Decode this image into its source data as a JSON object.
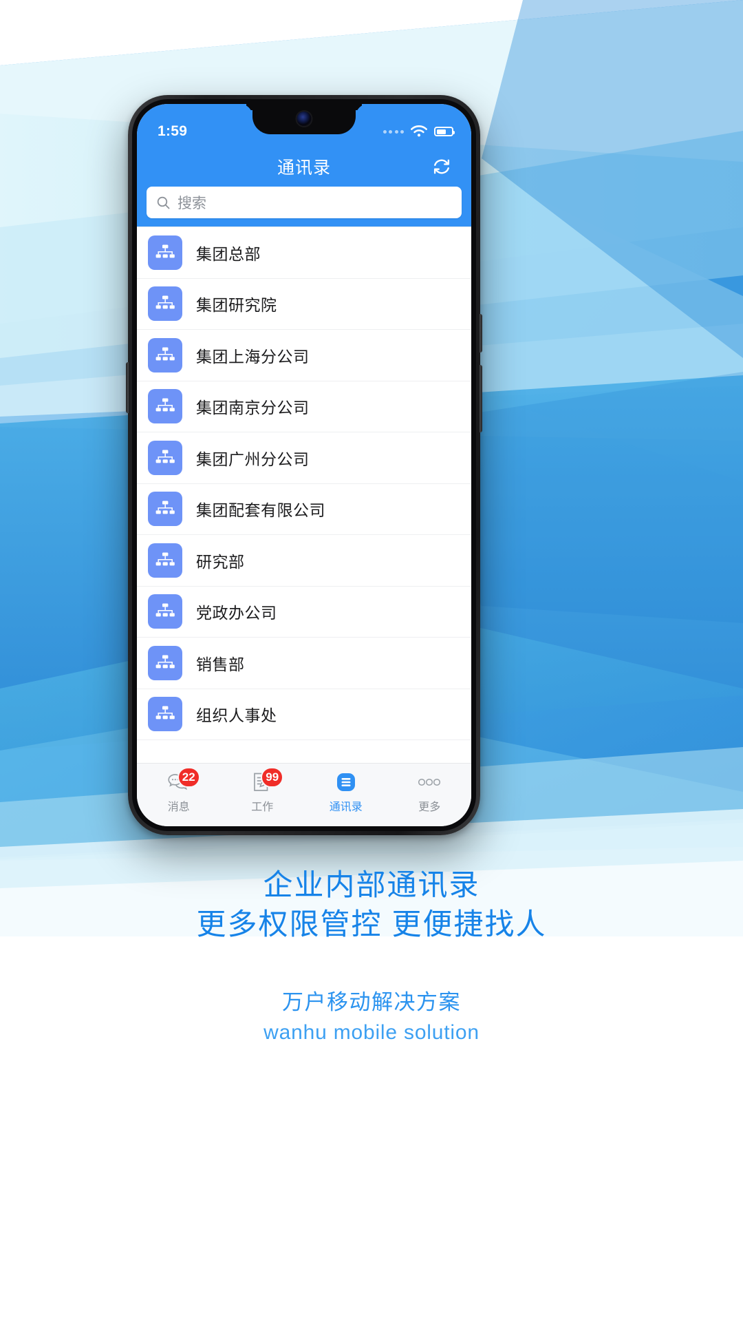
{
  "status_bar": {
    "time": "1:59",
    "signal_icon": "signal-dots-icon",
    "wifi_icon": "wifi-icon",
    "battery_icon": "battery-icon"
  },
  "nav": {
    "title": "通讯录",
    "refresh_icon": "refresh-icon"
  },
  "search": {
    "placeholder": "搜索",
    "value": "",
    "icon": "search-icon"
  },
  "list": {
    "item_icon": "org-chart-icon",
    "items": [
      {
        "label": "集团总部"
      },
      {
        "label": "集团研究院"
      },
      {
        "label": "集团上海分公司"
      },
      {
        "label": "集团南京分公司"
      },
      {
        "label": "集团广州分公司"
      },
      {
        "label": "集团配套有限公司"
      },
      {
        "label": "研究部"
      },
      {
        "label": "党政办公司"
      },
      {
        "label": "销售部"
      },
      {
        "label": "组织人事处"
      }
    ]
  },
  "tabbar": {
    "tabs": [
      {
        "label": "消息",
        "badge": "22",
        "icon": "chat-bubbles-icon",
        "active": false
      },
      {
        "label": "工作",
        "badge": "99",
        "icon": "document-pencil-icon",
        "active": false
      },
      {
        "label": "通讯录",
        "badge": "",
        "icon": "contacts-list-icon",
        "active": true
      },
      {
        "label": "更多",
        "badge": "",
        "icon": "more-dots-icon",
        "active": false
      }
    ]
  },
  "marketing": {
    "headline_line1": "企业内部通讯录",
    "headline_line2": "更多权限管控 更便捷找人",
    "sub_cn": "万户移动解决方案",
    "sub_en": "wanhu mobile solution"
  },
  "colors": {
    "brand_blue": "#3291f5",
    "accent_blue": "#1683e8",
    "icon_tile": "#6e93f7",
    "badge_red": "#f02d28",
    "tab_inactive": "#8b9096"
  }
}
